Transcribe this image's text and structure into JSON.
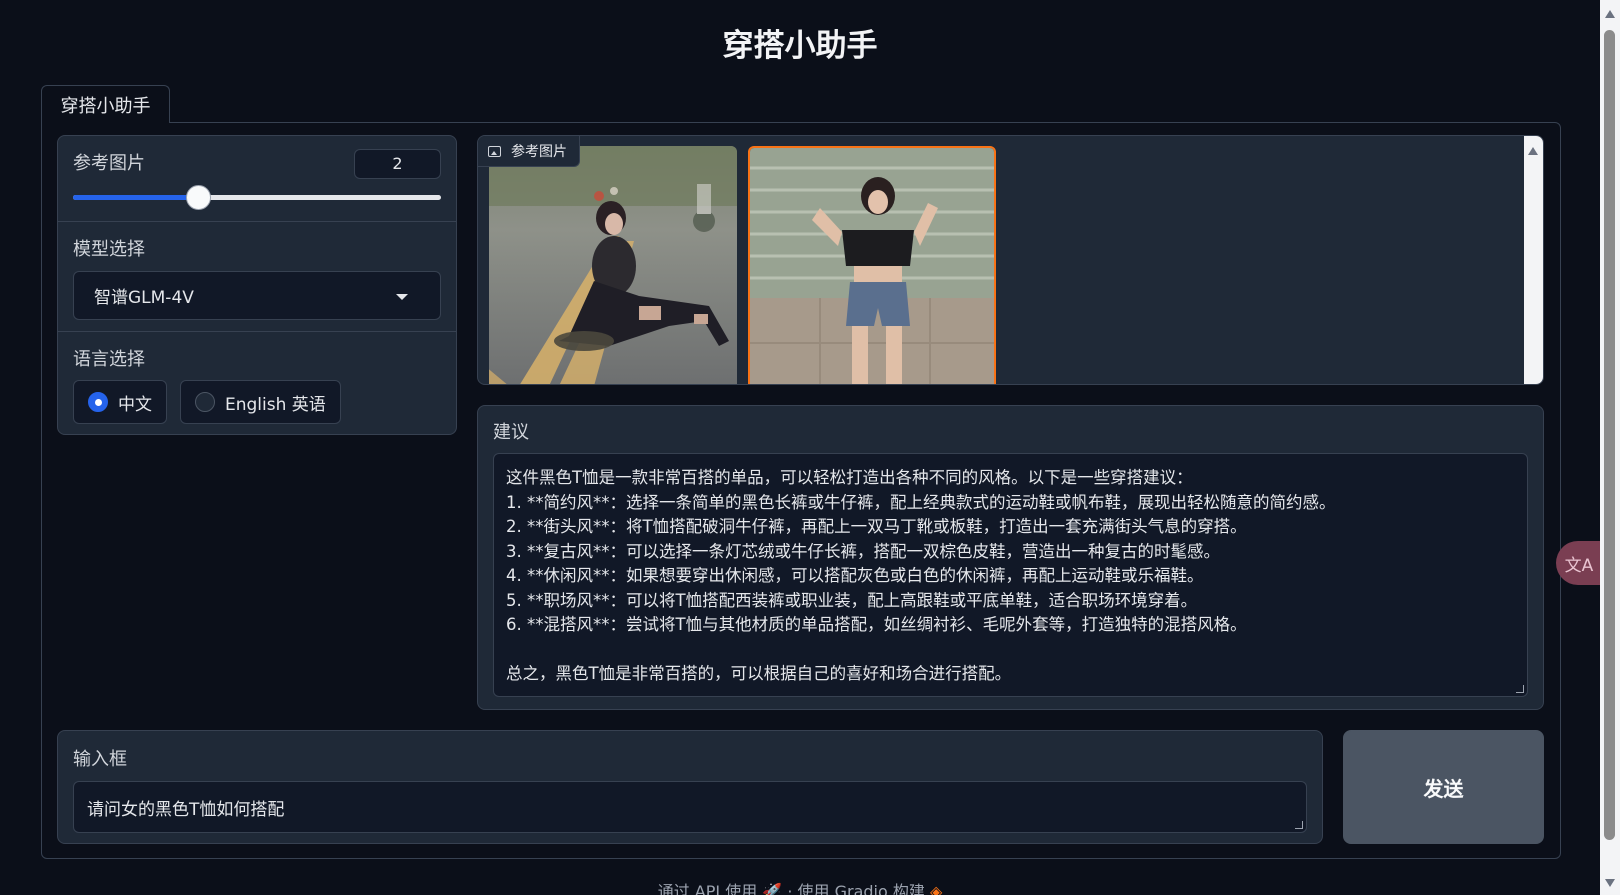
{
  "app": {
    "title": "穿搭小助手"
  },
  "tabs": [
    {
      "label": "穿搭小助手",
      "active": true
    }
  ],
  "controls": {
    "ref_images": {
      "label": "参考图片",
      "value": "2",
      "min": 1,
      "max": 5,
      "fraction": 0.34
    },
    "model": {
      "label": "模型选择",
      "selected": "智谱GLM-4V"
    },
    "language": {
      "label": "语言选择",
      "options": [
        {
          "label": "中文",
          "selected": true
        },
        {
          "label": "English 英语",
          "selected": false
        }
      ]
    }
  },
  "gallery": {
    "label": "参考图片",
    "images": [
      {
        "name": "photo-1",
        "selected": false
      },
      {
        "name": "photo-2",
        "selected": true
      }
    ]
  },
  "advice": {
    "label": "建议",
    "lines": [
      "这件黑色T恤是一款非常百搭的单品，可以轻松打造出各种不同的风格。以下是一些穿搭建议：",
      "1. **简约风**：选择一条简单的黑色长裤或牛仔裤，配上经典款式的运动鞋或帆布鞋，展现出轻松随意的简约感。",
      "2. **街头风**：将T恤搭配破洞牛仔裤，再配上一双马丁靴或板鞋，打造出一套充满街头气息的穿搭。",
      "3. **复古风**：可以选择一条灯芯绒或牛仔长裤，搭配一双棕色皮鞋，营造出一种复古的时髦感。",
      "4. **休闲风**：如果想要穿出休闲感，可以搭配灰色或白色的休闲裤，再配上运动鞋或乐福鞋。",
      "5. **职场风**：可以将T恤搭配西装裤或职业装，配上高跟鞋或平底单鞋，适合职场环境穿着。",
      "6. **混搭风**：尝试将T恤与其他材质的单品搭配，如丝绸衬衫、毛呢外套等，打造独特的混搭风格。",
      "",
      "总之，黑色T恤是非常百搭的，可以根据自己的喜好和场合进行搭配。"
    ]
  },
  "input": {
    "label": "输入框",
    "value": "请问女的黑色T恤如何搭配"
  },
  "send": {
    "label": "发送"
  },
  "footer": {
    "api": "通过 API 使用",
    "sep": "·",
    "built": "使用 Gradio 构建"
  },
  "colors": {
    "accent": "#2563eb",
    "selected_border": "#f97316",
    "background": "#0b0f19",
    "panel": "#1f2937"
  },
  "icons": {
    "gallery_label": "image-icon",
    "dropdown": "chevron-down-icon",
    "translate": "translate-icon",
    "api": "rocket-icon",
    "gradio": "gradio-logo-icon"
  }
}
